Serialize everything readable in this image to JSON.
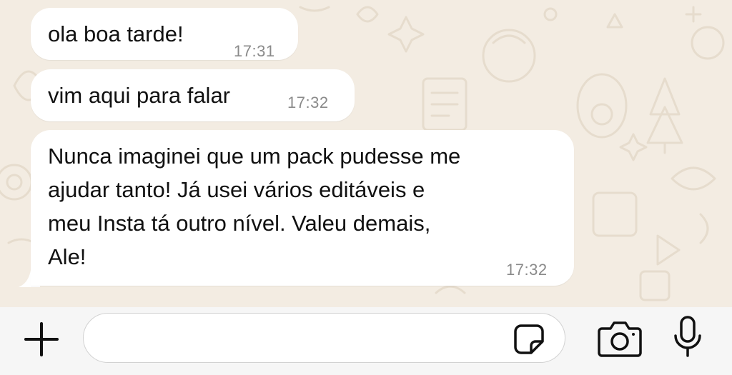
{
  "messages": [
    {
      "text": "ola boa tarde!",
      "time": "17:31"
    },
    {
      "text": "vim aqui para falar",
      "time": "17:32"
    },
    {
      "text": "Nunca imaginei que um pack pudesse me\najudar tanto! Já usei vários editáveis e\nmeu Insta tá outro nível. Valeu demais,\nAle!",
      "time": "17:32"
    }
  ],
  "composer": {
    "input_value": "",
    "icons": {
      "attach": "plus-icon",
      "sticker": "sticker-icon",
      "camera": "camera-icon",
      "mic": "microphone-icon"
    }
  },
  "colors": {
    "background": "#f3ece2",
    "bubble": "#ffffff",
    "timestamp": "#8a8a8a",
    "composer_bar": "#f6f6f6"
  }
}
